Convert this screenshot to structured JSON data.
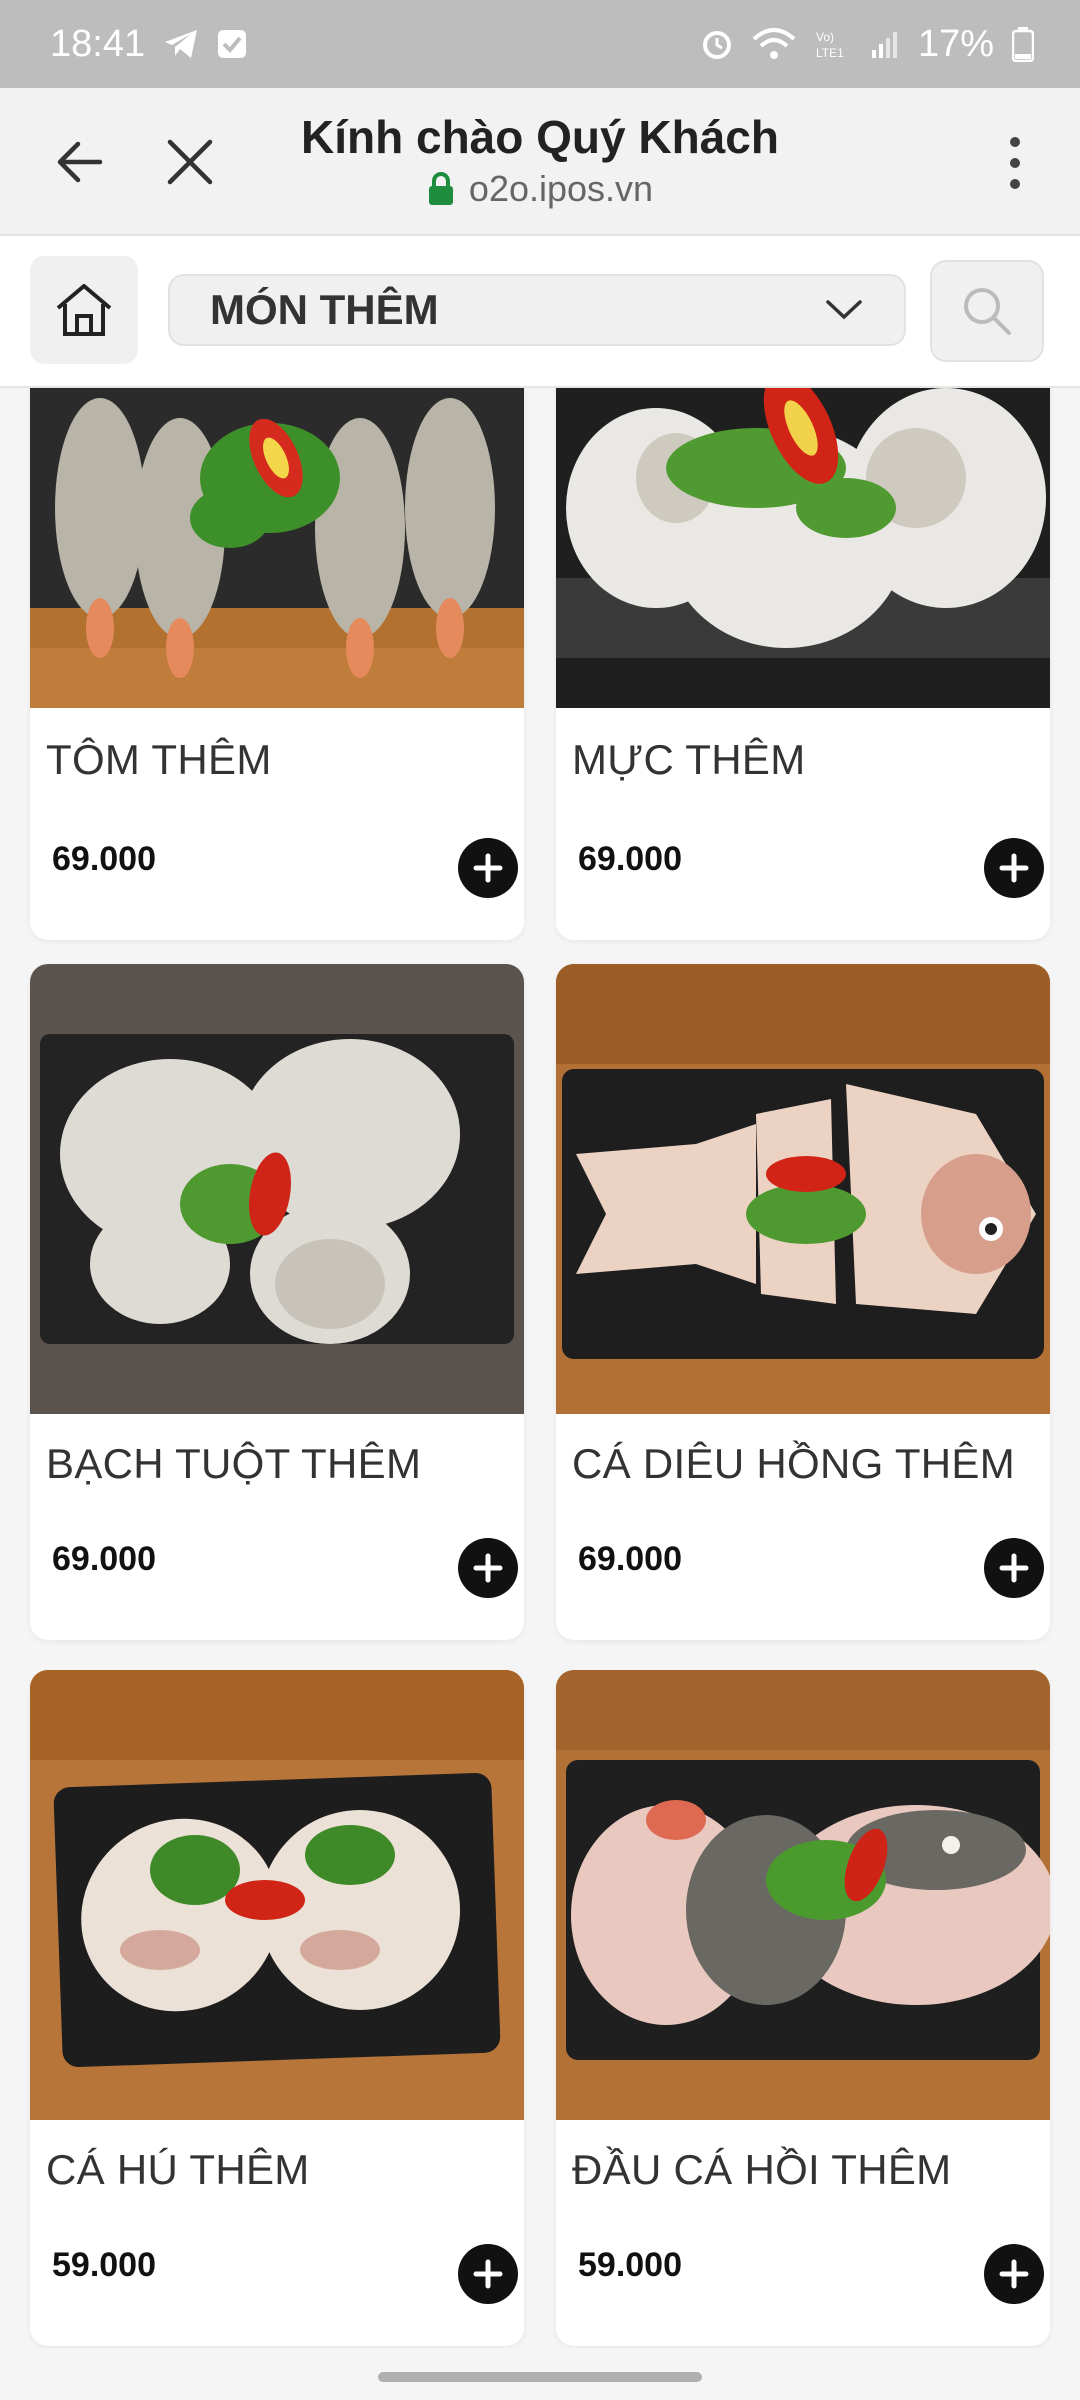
{
  "status_bar": {
    "time": "18:41",
    "battery": "17%",
    "left_icons": [
      "telegram-icon",
      "check-square-icon"
    ],
    "right_icons": [
      "alarm-icon",
      "wifi-icon",
      "volte-icon",
      "signal-icon",
      "battery-icon"
    ]
  },
  "browser": {
    "title": "Kính chào Quý Khách",
    "url": "o2o.ipos.vn"
  },
  "category": {
    "selected": "MÓN THÊM"
  },
  "products": [
    {
      "name": "TÔM THÊM",
      "price": "69.000"
    },
    {
      "name": "MỰC THÊM",
      "price": "69.000"
    },
    {
      "name": "BẠCH TUỘT THÊM",
      "price": "69.000"
    },
    {
      "name": "CÁ DIÊU HỒNG THÊM",
      "price": "69.000"
    },
    {
      "name": "CÁ HÚ THÊM",
      "price": "59.000"
    },
    {
      "name": "ĐẦU CÁ HỒI THÊM",
      "price": "59.000"
    }
  ],
  "colors": {
    "status_bar": "#bdbdbd",
    "toolbar": "#f2f2f2",
    "lock": "#1e8e3e",
    "add_button": "#111111"
  }
}
